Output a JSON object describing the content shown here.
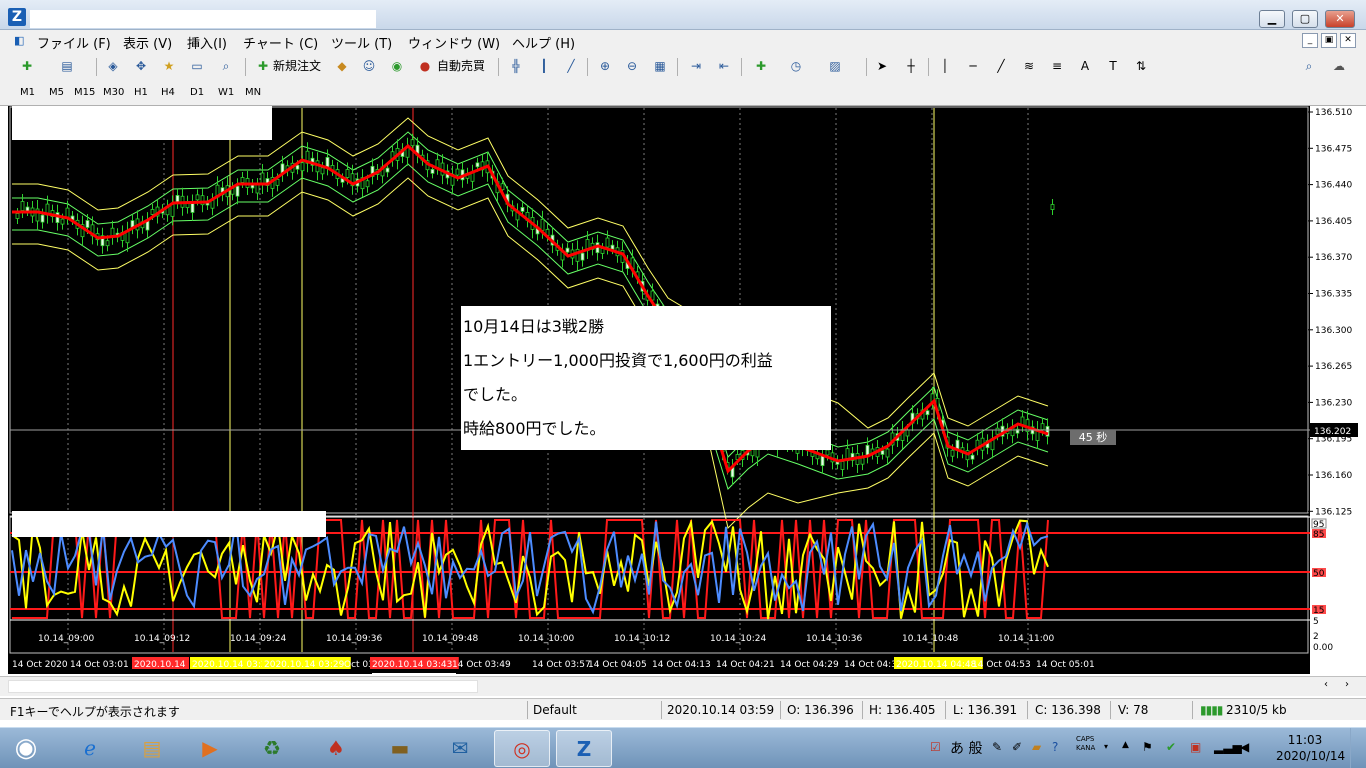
{
  "window": {
    "menu": [
      "ファイル (F)",
      "表示 (V)",
      "挿入(I)",
      "チャート (C)",
      "ツール (T)",
      "ウィンドウ (W)",
      "ヘルプ (H)"
    ]
  },
  "toolbar": {
    "new_order": "新規注文",
    "auto_trade": "自動売買"
  },
  "timeframes": [
    "M1",
    "M5",
    "M15",
    "M30",
    "H1",
    "H4",
    "D1",
    "W1",
    "MN"
  ],
  "annotation": {
    "line1": "10月14日は3戦2勝",
    "line2": "1エントリー1,000円投資で1,600円の利益",
    "line3": "でした。",
    "line4": "時給800円でした。"
  },
  "timer": "45 秒",
  "price_axis": [
    "136.510",
    "136.475",
    "136.440",
    "136.405",
    "136.370",
    "136.335",
    "136.300",
    "136.265",
    "136.230",
    "136.195",
    "136.160",
    "136.125"
  ],
  "current_price": "136.202",
  "osc_axis": {
    "l95": "95",
    "l85": "85",
    "l50": "50",
    "l15": "15",
    "l5": "5",
    "l2": "2",
    "l0": "0.00"
  },
  "sub_time_labels": [
    "10.14_09:00",
    "10.14_09:12",
    "10.14_09:24",
    "10.14_09:36",
    "10.14_09:48",
    "10.14_10:00",
    "10.14_10:12",
    "10.14_10:24",
    "10.14_10:36",
    "10.14_10:48",
    "10.14_11:00"
  ],
  "time_axis": [
    "14 Oct 2020",
    "14 Oct 03:01",
    "2020.10.14",
    "2020.10.14 03:2",
    "2020.10.14 03:29",
    "Oct 03",
    "2020.10.14 03:43",
    "14 Oct 03:49",
    "14 Oct 03:57",
    "14 Oct 04:05",
    "14 Oct 04:13",
    "14 Oct 04:21",
    "14 Oct 04:29",
    "14 Oct 04:3",
    "2020.10.14 04:48",
    "14 Oct 04:53",
    "14 Oct 05:01"
  ],
  "status": {
    "help": "F1キーでヘルプが表示されます",
    "profile": "Default",
    "datetime": "2020.10.14 03:59",
    "open": "O: 136.396",
    "high": "H: 136.405",
    "low": "L: 136.391",
    "close": "C: 136.398",
    "volume": "V: 78",
    "traffic": "2310/5 kb"
  },
  "taskbar": {
    "time": "11:03",
    "date": "2020/10/14",
    "ime": "あ 般",
    "caps": "CAPS",
    "kana": "KANA"
  },
  "colors": {
    "price_line": "#ff0000",
    "ma": "#ff0000",
    "band_outer": "#ffff66",
    "band_inner": "#66ff66",
    "osc_red": "#ff1a1a",
    "osc_yellow": "#ffff00",
    "osc_blue": "#4d8cff"
  }
}
